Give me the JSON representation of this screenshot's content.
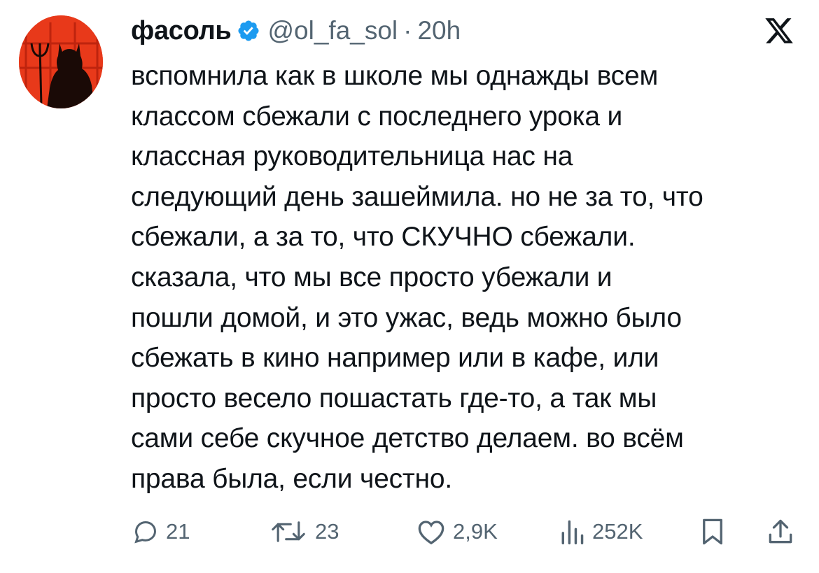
{
  "author": {
    "display_name": "фасоль",
    "handle": "@ol_fa_sol",
    "separator": "·",
    "time": "20h",
    "verified": true,
    "avatar_icon": "devil-silhouette-avatar"
  },
  "platform_logo": "x-logo-icon",
  "tweet": {
    "lines": [
      "вспомнила как в школе мы однажды всем",
      "классом сбежали с последнего урока и",
      "классная руководительница нас на",
      "следующий день зашеймила. но не за то, что",
      "сбежали, а за то, что СКУЧНО сбежали.",
      "сказала, что мы все просто убежали и",
      "пошли домой, и это ужас, ведь можно было",
      "сбежать в кино например или в кафе, или",
      "просто весело пошастать где-то, а так мы",
      "сами себе скучное детство делаем. во всём",
      "права была, если честно."
    ]
  },
  "actions": {
    "replies": "21",
    "retweets": "23",
    "likes": "2,9K",
    "views": "252K"
  },
  "colors": {
    "text": "#0f1419",
    "muted": "#536471",
    "verified": "#1d9bf0",
    "avatar_bg": "#e8391a"
  }
}
